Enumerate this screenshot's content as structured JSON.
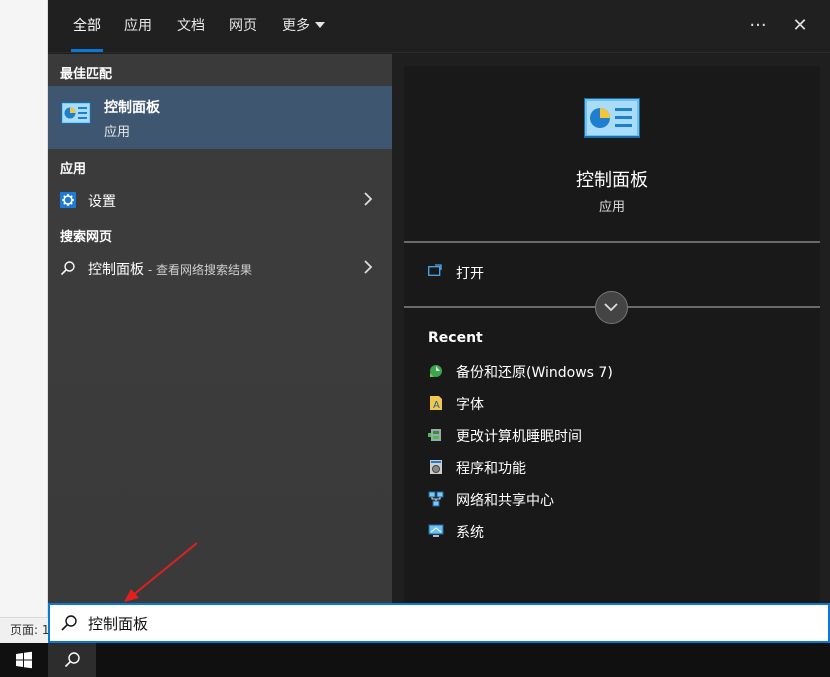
{
  "tabs": [
    {
      "label": "全部",
      "active": true
    },
    {
      "label": "应用"
    },
    {
      "label": "文档"
    },
    {
      "label": "网页"
    },
    {
      "label": "更多"
    }
  ],
  "top_icons": {
    "more": "···",
    "close": "✕"
  },
  "sections": {
    "best_match": "最佳匹配",
    "apps": "应用",
    "web": "搜索网页"
  },
  "best_match": {
    "title": "控制面板",
    "subtitle": "应用",
    "icon": "control-panel-icon"
  },
  "apps": [
    {
      "label": "设置",
      "icon": "settings-gear-icon"
    }
  ],
  "web": [
    {
      "label": "控制面板",
      "suffix": " - 查看网络搜索结果",
      "icon": "search-icon"
    }
  ],
  "preview": {
    "title": "控制面板",
    "subtitle": "应用",
    "open_label": "打开",
    "recent_header": "Recent",
    "recent": [
      {
        "label": "备份和还原(Windows 7)",
        "icon": "backup-restore-icon"
      },
      {
        "label": "字体",
        "icon": "fonts-icon"
      },
      {
        "label": "更改计算机睡眠时间",
        "icon": "power-options-icon"
      },
      {
        "label": "程序和功能",
        "icon": "programs-features-icon"
      },
      {
        "label": "网络和共享中心",
        "icon": "network-center-icon"
      },
      {
        "label": "系统",
        "icon": "system-icon"
      }
    ]
  },
  "search": {
    "value": "控制面板"
  },
  "background": {
    "status_text": "页面: 1"
  },
  "colors": {
    "accent": "#0a78d7",
    "selected": "#3e5670",
    "annotation_arrow": "#e02020"
  }
}
